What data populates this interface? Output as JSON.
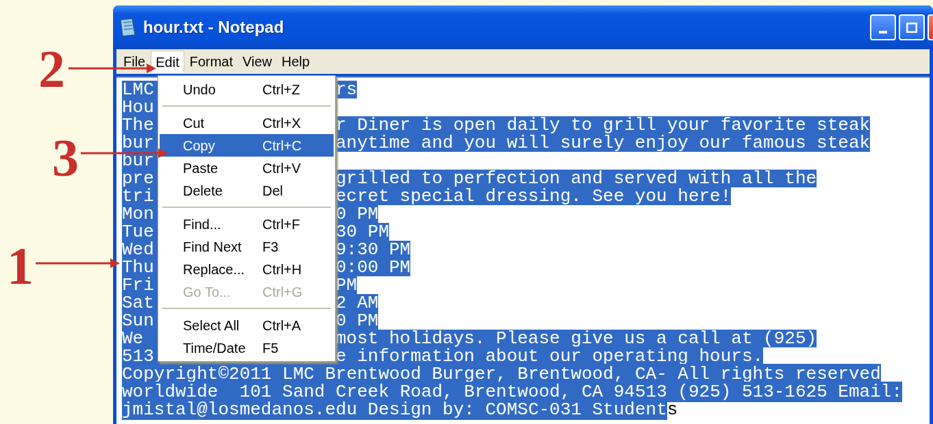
{
  "window": {
    "title": "hour.txt - Notepad"
  },
  "menu_bar": [
    {
      "label": "File",
      "selected": false
    },
    {
      "label": "Edit",
      "selected": true
    },
    {
      "label": "Format",
      "selected": false
    },
    {
      "label": "View",
      "selected": false
    },
    {
      "label": "Help",
      "selected": false
    }
  ],
  "edit_menu": [
    {
      "kind": "item",
      "label": "Undo",
      "shortcut": "Ctrl+Z",
      "selected": false,
      "disabled": false
    },
    {
      "kind": "separator"
    },
    {
      "kind": "item",
      "label": "Cut",
      "shortcut": "Ctrl+X",
      "selected": false,
      "disabled": false
    },
    {
      "kind": "item",
      "label": "Copy",
      "shortcut": "Ctrl+C",
      "selected": true,
      "disabled": false
    },
    {
      "kind": "item",
      "label": "Paste",
      "shortcut": "Ctrl+V",
      "selected": false,
      "disabled": false
    },
    {
      "kind": "item",
      "label": "Delete",
      "shortcut": "Del",
      "selected": false,
      "disabled": false
    },
    {
      "kind": "separator"
    },
    {
      "kind": "item",
      "label": "Find...",
      "shortcut": "Ctrl+F",
      "selected": false,
      "disabled": false
    },
    {
      "kind": "item",
      "label": "Find Next",
      "shortcut": "F3",
      "selected": false,
      "disabled": false
    },
    {
      "kind": "item",
      "label": "Replace...",
      "shortcut": "Ctrl+H",
      "selected": false,
      "disabled": false
    },
    {
      "kind": "item",
      "label": "Go To...",
      "shortcut": "Ctrl+G",
      "selected": false,
      "disabled": true
    },
    {
      "kind": "separator"
    },
    {
      "kind": "item",
      "label": "Select All",
      "shortcut": "Ctrl+A",
      "selected": false,
      "disabled": false
    },
    {
      "kind": "item",
      "label": "Time/Date",
      "shortcut": "F5",
      "selected": false,
      "disabled": false
    }
  ],
  "editor_lines": [
    {
      "kind": "split",
      "segments": [
        {
          "text": "LMC",
          "selected": true
        },
        {
          "text": "rs",
          "selected": true
        }
      ]
    },
    {
      "kind": "split",
      "segments": [
        {
          "text": "Hou",
          "selected": true
        }
      ]
    },
    {
      "kind": "split",
      "segments": [
        {
          "text": "The",
          "selected": true
        },
        {
          "text": "r Diner is open daily to grill your favorite steak",
          "selected": true
        }
      ]
    },
    {
      "kind": "split",
      "segments": [
        {
          "text": "bur",
          "selected": true
        },
        {
          "text": "anytime and you will surely enjoy our famous steak",
          "selected": true
        }
      ]
    },
    {
      "kind": "split",
      "segments": [
        {
          "text": "bur",
          "selected": true
        }
      ]
    },
    {
      "kind": "split",
      "segments": [
        {
          "text": "pre",
          "selected": true
        },
        {
          "text": "grilled to perfection and served with all the",
          "selected": true
        }
      ]
    },
    {
      "kind": "split",
      "segments": [
        {
          "text": "tri",
          "selected": true
        },
        {
          "text": "ecret special dressing. See you here!",
          "selected": true
        }
      ]
    },
    {
      "kind": "split",
      "segments": [
        {
          "text": "Mon",
          "selected": true
        },
        {
          "text": "0 PM",
          "selected": true
        }
      ]
    },
    {
      "kind": "split",
      "segments": [
        {
          "text": "Tue",
          "selected": true
        },
        {
          "text": "30 PM",
          "selected": true
        }
      ]
    },
    {
      "kind": "split",
      "segments": [
        {
          "text": "Wed",
          "selected": true
        },
        {
          "text": "9:30 PM",
          "selected": true
        }
      ]
    },
    {
      "kind": "split",
      "segments": [
        {
          "text": "Thu",
          "selected": true
        },
        {
          "text": "0:00 PM",
          "selected": true
        }
      ]
    },
    {
      "kind": "split",
      "segments": [
        {
          "text": "Fri",
          "selected": true
        },
        {
          "text": "PM",
          "selected": true
        }
      ]
    },
    {
      "kind": "split",
      "segments": [
        {
          "text": "Sat",
          "selected": true
        },
        {
          "text": "2 AM",
          "selected": true
        }
      ]
    },
    {
      "kind": "split",
      "segments": [
        {
          "text": "Sun",
          "selected": true
        },
        {
          "text": "0 PM",
          "selected": true
        }
      ]
    },
    {
      "kind": "split",
      "segments": [
        {
          "text": "We",
          "selected": true
        },
        {
          "text": "most holidays. Please give us a call at (925)",
          "selected": true
        }
      ]
    },
    {
      "kind": "split",
      "segments": [
        {
          "text": "513",
          "selected": true
        },
        {
          "text": "e information about our operating hours.",
          "selected": true
        }
      ]
    },
    {
      "kind": "full",
      "segments": [
        {
          "text": "Copyright©2011 LMC Brentwood Burger, Brentwood, CA- All rights reserved",
          "selected": true
        }
      ]
    },
    {
      "kind": "full",
      "segments": [
        {
          "text": "worldwide  101 Sand Creek Road, Brentwood, CA 94513 (925) 513-1625 Email:",
          "selected": true
        }
      ]
    },
    {
      "kind": "full",
      "segments": [
        {
          "text": "jmistal@losmedanos.edu Design by: COMSC-031 Student",
          "selected": true
        },
        {
          "text": "s",
          "selected": false
        }
      ]
    }
  ],
  "annotations": [
    {
      "number": "2",
      "kind": "menu"
    },
    {
      "number": "3",
      "kind": "item"
    },
    {
      "number": "1",
      "kind": "selection"
    }
  ]
}
